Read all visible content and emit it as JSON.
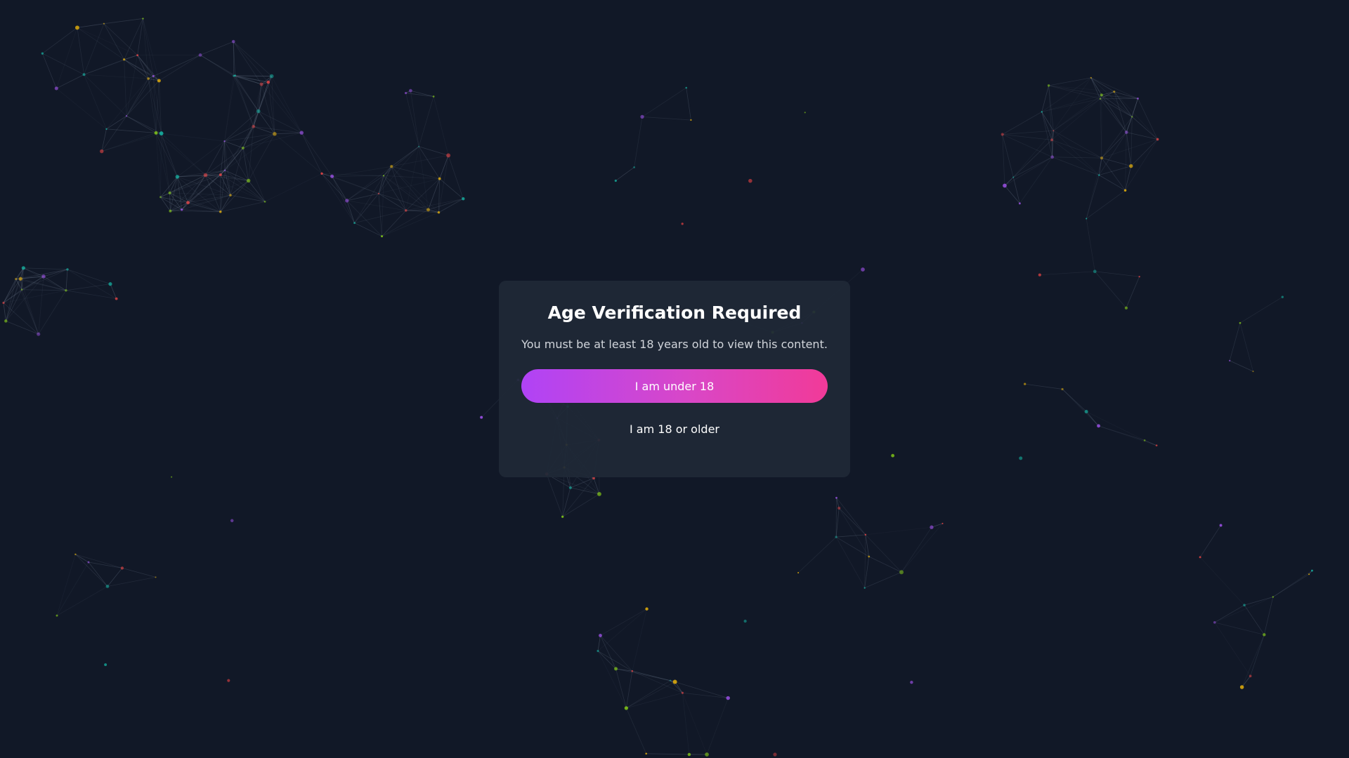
{
  "modal": {
    "title": "Age Verification Required",
    "message": "You must be at least 18 years old to view this content.",
    "under_button_label": "I am under 18",
    "over_button_label": "I am 18 or older"
  },
  "colors": {
    "page_background": "#111827",
    "modal_background": "#1f2937",
    "gradient_start": "#b043f6",
    "gradient_end": "#f13a98",
    "node_palette": [
      "#a855f7",
      "#ef4444",
      "#84cc16",
      "#14b8a6",
      "#eab308"
    ]
  }
}
